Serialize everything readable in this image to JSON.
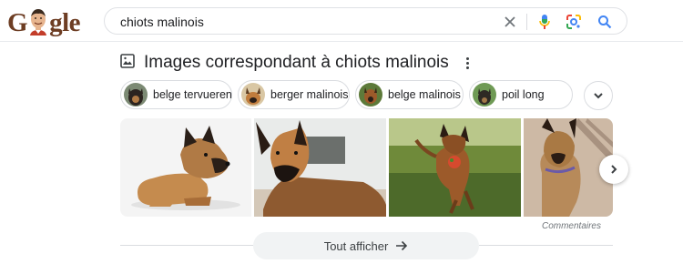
{
  "header": {
    "logo_text_left": "G",
    "logo_text_right": "gle",
    "search_value": "chiots malinois"
  },
  "icons": {
    "clear": "close-icon",
    "voice": "microphone-icon",
    "lens": "google-lens-icon",
    "search": "search-icon"
  },
  "section": {
    "title": "Images correspondant à chiots malinois"
  },
  "chips": [
    {
      "label": "belge tervueren"
    },
    {
      "label": "berger malinois"
    },
    {
      "label": "belge malinois"
    },
    {
      "label": "poil long"
    }
  ],
  "images": [
    {
      "alt": "puppy-lying"
    },
    {
      "alt": "puppy-closeup"
    },
    {
      "alt": "puppy-running"
    },
    {
      "alt": "puppy-sitting"
    }
  ],
  "feedback_label": "Commentaires",
  "show_all": {
    "label": "Tout afficher"
  },
  "colors": {
    "brand_blue": "#4285f4",
    "brand_red": "#ea4335",
    "brand_yellow": "#fbbc05",
    "brand_green": "#34a853",
    "logo_brown": "#6d3d23",
    "border": "#dadce0"
  }
}
